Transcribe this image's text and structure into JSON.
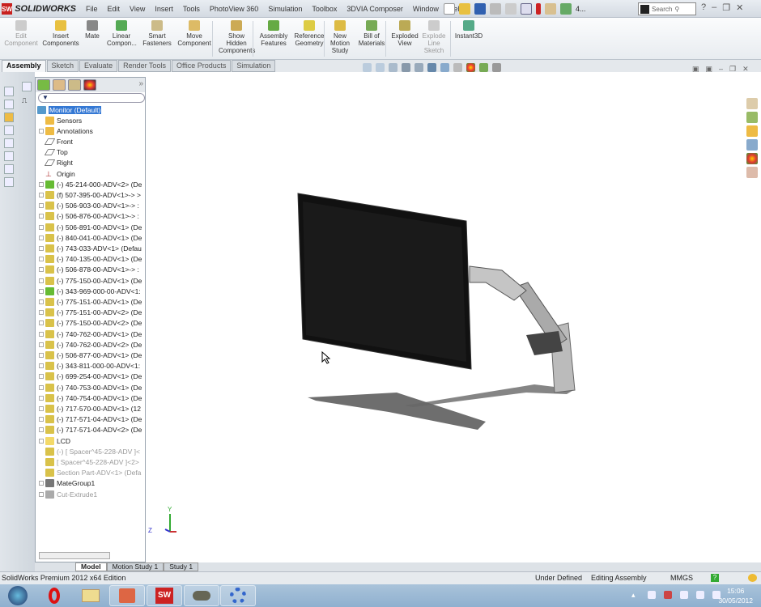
{
  "app": {
    "name": "SOLIDWORKS",
    "logo_mark": "SW"
  },
  "menu": [
    "File",
    "Edit",
    "View",
    "Insert",
    "Tools",
    "PhotoView 360",
    "Simulation",
    "Toolbox",
    "3DVIA Composer",
    "Window",
    "Help"
  ],
  "quick_toolbar": {
    "recent_label": "4...",
    "search_placeholder": "Search"
  },
  "ribbon": {
    "buttons": [
      {
        "label": "Edit Component",
        "disabled": true
      },
      {
        "label": "Insert Components"
      },
      {
        "label": "Mate"
      },
      {
        "label": "Linear Compon..."
      },
      {
        "label": "Smart Fasteners"
      },
      {
        "label": "Move Component"
      },
      {
        "label": "Show Hidden Components"
      },
      {
        "label": "Assembly Features"
      },
      {
        "label": "Reference Geometry"
      },
      {
        "label": "New Motion Study"
      },
      {
        "label": "Bill of Materials"
      },
      {
        "label": "Exploded View"
      },
      {
        "label": "Explode Line Sketch",
        "disabled": true
      },
      {
        "label": "Instant3D"
      }
    ]
  },
  "command_tabs": [
    {
      "label": "Assembly",
      "active": true
    },
    {
      "label": "Sketch"
    },
    {
      "label": "Evaluate"
    },
    {
      "label": "Render Tools"
    },
    {
      "label": "Office Products"
    },
    {
      "label": "Simulation"
    }
  ],
  "tree": {
    "root": "Monitor  (Default)",
    "items": [
      {
        "label": "Sensors",
        "icon": "sensor-folder-icon"
      },
      {
        "label": "Annotations",
        "icon": "annotations-icon",
        "exp": true
      },
      {
        "label": "Front",
        "icon": "plane-icon"
      },
      {
        "label": "Top",
        "icon": "plane-icon"
      },
      {
        "label": "Right",
        "icon": "plane-icon"
      },
      {
        "label": "Origin",
        "icon": "origin-icon"
      },
      {
        "label": "(-) 45-214-000-ADV<2> (De",
        "icon": "subassembly-icon",
        "exp": true
      },
      {
        "label": "(f) 507-395-00-ADV<1>-> >",
        "icon": "part-icon",
        "exp": true
      },
      {
        "label": "(-) 506-903-00-ADV<1>-> :",
        "icon": "part-icon",
        "exp": true
      },
      {
        "label": "(-) 506-876-00-ADV<1>-> :",
        "icon": "part-icon",
        "exp": true
      },
      {
        "label": "(-) 506-891-00-ADV<1> (De",
        "icon": "part-icon",
        "exp": true
      },
      {
        "label": "(-) 840-041-00-ADV<1> (De",
        "icon": "part-icon",
        "exp": true
      },
      {
        "label": "(-) 743-033-ADV<1> (Defau",
        "icon": "part-icon",
        "exp": true
      },
      {
        "label": "(-) 740-135-00-ADV<1> (De",
        "icon": "part-icon",
        "exp": true
      },
      {
        "label": "(-) 506-878-00-ADV<1>-> :",
        "icon": "part-icon",
        "exp": true
      },
      {
        "label": "(-) 775-150-00-ADV<1> (De",
        "icon": "part-icon",
        "exp": true
      },
      {
        "label": "(-) 343-969-000-00-ADV<1:",
        "icon": "subassembly-icon",
        "exp": true
      },
      {
        "label": "(-) 775-151-00-ADV<1> (De",
        "icon": "part-icon",
        "exp": true
      },
      {
        "label": "(-) 775-151-00-ADV<2> (De",
        "icon": "part-icon",
        "exp": true
      },
      {
        "label": "(-) 775-150-00-ADV<2> (De",
        "icon": "part-icon",
        "exp": true
      },
      {
        "label": "(-) 740-762-00-ADV<1> (De",
        "icon": "part-icon",
        "exp": true
      },
      {
        "label": "(-) 740-762-00-ADV<2> (De",
        "icon": "part-icon",
        "exp": true
      },
      {
        "label": "(-) 506-877-00-ADV<1> (De",
        "icon": "part-icon",
        "exp": true
      },
      {
        "label": "(-) 343-811-000-00-ADV<1:",
        "icon": "part-icon",
        "exp": true
      },
      {
        "label": "(-) 699-254-00-ADV<1> (De",
        "icon": "part-icon",
        "exp": true
      },
      {
        "label": "(-) 740-753-00-ADV<1> (De",
        "icon": "part-icon",
        "exp": true
      },
      {
        "label": "(-) 740-754-00-ADV<1> (De",
        "icon": "part-icon",
        "exp": true
      },
      {
        "label": "(-) 717-570-00-ADV<1> (12",
        "icon": "part-icon",
        "exp": true
      },
      {
        "label": "(-) 717-571-04-ADV<1> (De",
        "icon": "part-icon",
        "exp": true
      },
      {
        "label": "(-) 717-571-04-ADV<2> (De",
        "icon": "part-icon",
        "exp": true
      },
      {
        "label": "LCD",
        "icon": "folder-icon",
        "exp": true
      },
      {
        "label": "(-) [ Spacer^45-228-ADV ]<",
        "icon": "part-icon",
        "grey": true
      },
      {
        "label": "[ Spacer^45-228-ADV ]<2>",
        "icon": "part-icon",
        "grey": true
      },
      {
        "label": "Section Part-ADV<1> (Defa",
        "icon": "part-icon",
        "grey": true
      },
      {
        "label": "MateGroup1",
        "icon": "mates-icon",
        "exp": true
      },
      {
        "label": "Cut-Extrude1",
        "icon": "cut-extrude-icon",
        "exp": true,
        "grey": true
      }
    ]
  },
  "bottom_tabs": [
    {
      "label": "Model",
      "active": true
    },
    {
      "label": "Motion Study 1"
    },
    {
      "label": "Study 1"
    }
  ],
  "triad": {
    "y": "Y",
    "z": "Z"
  },
  "status": {
    "edition": "SolidWorks Premium 2012 x64 Edition",
    "defined": "Under Defined",
    "mode": "Editing Assembly",
    "units": "MMGS"
  },
  "taskbar": {
    "time": "15:06",
    "date": "30/05/2012",
    "apps": [
      "start-orb-icon",
      "opera-icon",
      "explorer-icon",
      "powerpoint-icon",
      "solidworks-icon",
      "gimp-icon",
      "network-app-icon"
    ]
  },
  "colors": {
    "selection": "#3478d4",
    "brand": "#c8201e"
  }
}
